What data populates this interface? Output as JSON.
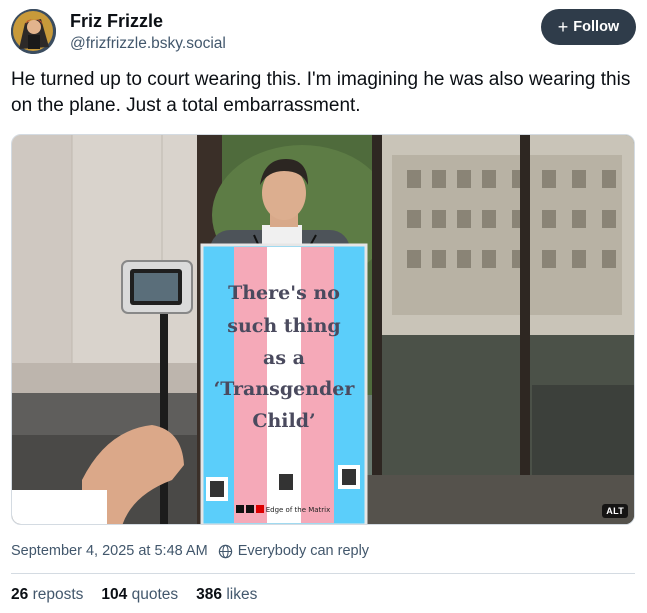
{
  "author": {
    "name": "Friz Frizzle",
    "handle": "@frizfrizzle.bsky.social"
  },
  "follow_label": "Follow",
  "post": {
    "text": "He turned up to court wearing this. I'm imagining he was also wearing this on the plane. Just a total embarrassment."
  },
  "image": {
    "sign_lines": [
      "There's no",
      "such thing",
      "as a",
      "‘Transgender",
      "Child’"
    ],
    "sign_footer": "Edge of the Matrix",
    "alt_badge": "ALT",
    "flag_colors": [
      "#5bcefa",
      "#f5a9b8",
      "#ffffff",
      "#f5a9b8",
      "#5bcefa"
    ]
  },
  "meta": {
    "timestamp": "September 4, 2025 at 5:48 AM",
    "reply_setting": "Everybody can reply"
  },
  "stats": {
    "reposts_count": "26",
    "reposts_label": "reposts",
    "quotes_count": "104",
    "quotes_label": "quotes",
    "likes_count": "386",
    "likes_label": "likes"
  },
  "icons": {
    "reply_setting": "globe-icon",
    "follow": "plus-icon"
  }
}
